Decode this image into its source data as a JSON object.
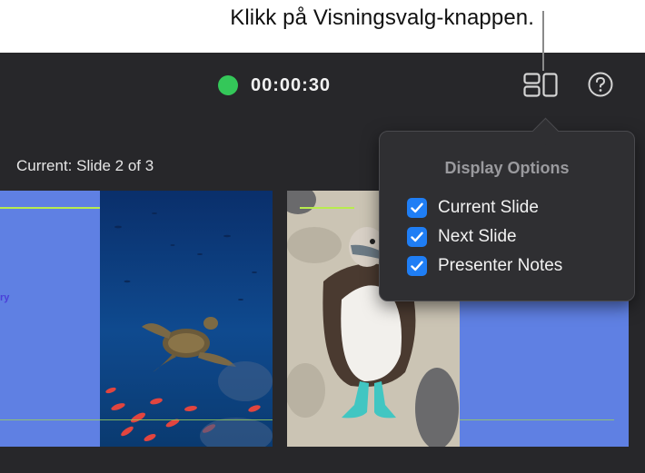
{
  "callout": {
    "text": "Klikk på Visningsvalg-knappen."
  },
  "toolbar": {
    "timer": "00:00:30",
    "status_color": "#34c759",
    "view_button_icon": "display-options-icon",
    "help_button_icon": "help-icon"
  },
  "main": {
    "current_label": "Current: Slide 2 of 3",
    "current_slide_partial_text": "ry"
  },
  "popover": {
    "title": "Display Options",
    "options": [
      {
        "label": "Current Slide",
        "checked": true
      },
      {
        "label": "Next Slide",
        "checked": true
      },
      {
        "label": "Presenter Notes",
        "checked": true
      }
    ]
  },
  "colors": {
    "background": "#27272a",
    "slide_blue": "#5f80e3",
    "accent_line": "#b8ec4e",
    "checkbox_blue": "#1f7ef5"
  }
}
